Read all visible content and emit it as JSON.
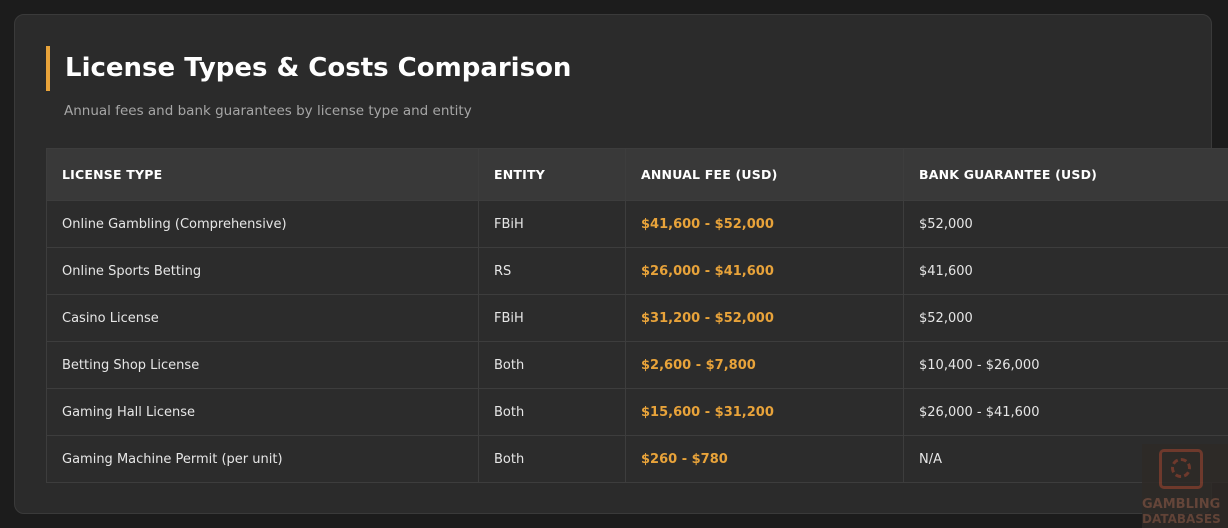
{
  "header": {
    "title": "License Types & Costs Comparison",
    "subtitle": "Annual fees and bank guarantees by license type and entity"
  },
  "table": {
    "columns": [
      "LICENSE TYPE",
      "ENTITY",
      "ANNUAL FEE (USD)",
      "BANK GUARANTEE (USD)"
    ],
    "rows": [
      {
        "license_type": "Online Gambling (Comprehensive)",
        "entity": "FBiH",
        "annual_fee": "$41,600 - $52,000",
        "bank_guarantee": "$52,000"
      },
      {
        "license_type": "Online Sports Betting",
        "entity": "RS",
        "annual_fee": "$26,000 - $41,600",
        "bank_guarantee": "$41,600"
      },
      {
        "license_type": "Casino License",
        "entity": "FBiH",
        "annual_fee": "$31,200 - $52,000",
        "bank_guarantee": "$52,000"
      },
      {
        "license_type": "Betting Shop License",
        "entity": "Both",
        "annual_fee": "$2,600 - $7,800",
        "bank_guarantee": "$10,400 - $26,000"
      },
      {
        "license_type": "Gaming Hall License",
        "entity": "Both",
        "annual_fee": "$15,600 - $31,200",
        "bank_guarantee": "$26,000 - $41,600"
      },
      {
        "license_type": "Gaming Machine Permit (per unit)",
        "entity": "Both",
        "annual_fee": "$260 - $780",
        "bank_guarantee": "N/A"
      }
    ]
  },
  "watermark": {
    "line1": "GAMBLING",
    "line2": "DATABASES"
  },
  "colors": {
    "accent": "#e8a33a",
    "background": "#1c1c1c",
    "card": "#2b2b2b"
  }
}
